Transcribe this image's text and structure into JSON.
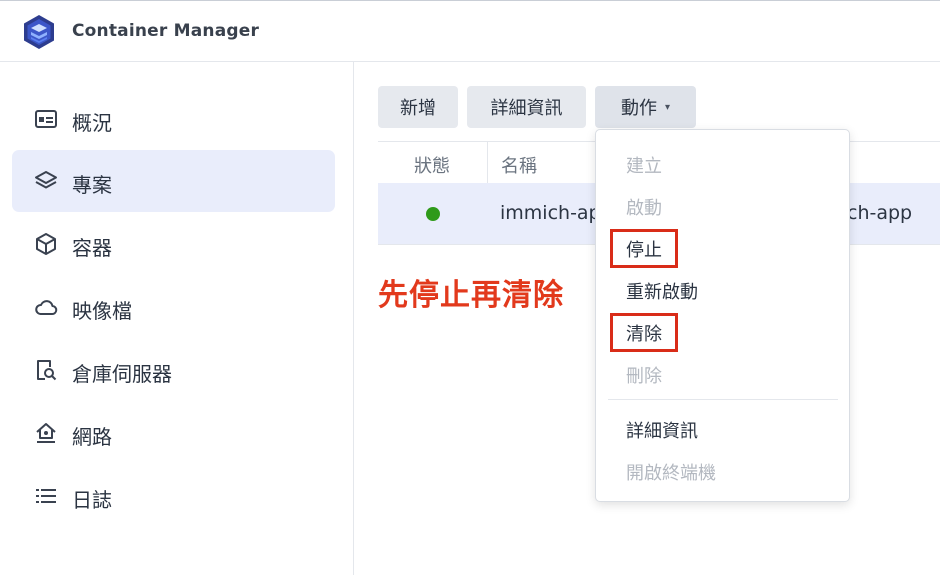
{
  "app": {
    "title": "Container Manager",
    "logo_icon": "container-manager-logo-icon"
  },
  "sidebar": {
    "items": [
      {
        "label": "概況",
        "icon": "overview-icon",
        "active": false
      },
      {
        "label": "專案",
        "icon": "layers-icon",
        "active": true
      },
      {
        "label": "容器",
        "icon": "cube-icon",
        "active": false
      },
      {
        "label": "映像檔",
        "icon": "cloud-icon",
        "active": false
      },
      {
        "label": "倉庫伺服器",
        "icon": "registry-search-icon",
        "active": false
      },
      {
        "label": "網路",
        "icon": "home-network-icon",
        "active": false
      },
      {
        "label": "日誌",
        "icon": "list-icon",
        "active": false
      }
    ]
  },
  "toolbar": {
    "add_label": "新增",
    "detail_label": "詳細資訊",
    "action_label": "動作",
    "action_caret": "▾"
  },
  "table": {
    "columns": [
      "狀態",
      "名稱"
    ],
    "rows": [
      {
        "status": "running",
        "name": "immich-ap",
        "path_tail": "ch-app"
      }
    ]
  },
  "annotation": {
    "text": "先停止再清除",
    "color": "#e2391c"
  },
  "action_menu": {
    "items": [
      {
        "label": "建立",
        "disabled": true,
        "highlighted": false
      },
      {
        "label": "啟動",
        "disabled": true,
        "highlighted": false
      },
      {
        "label": "停止",
        "disabled": false,
        "highlighted": true
      },
      {
        "label": "重新啟動",
        "disabled": false,
        "highlighted": false
      },
      {
        "label": "清除",
        "disabled": false,
        "highlighted": true
      },
      {
        "label": "刪除",
        "disabled": true,
        "highlighted": false
      },
      {
        "label": "詳細資訊",
        "disabled": false,
        "highlighted": false
      },
      {
        "label": "開啟終端機",
        "disabled": true,
        "highlighted": false
      }
    ]
  },
  "colors": {
    "accent_bg": "#e9edfb",
    "status_running": "#2f9a1a",
    "highlight_border": "#d92c18"
  }
}
